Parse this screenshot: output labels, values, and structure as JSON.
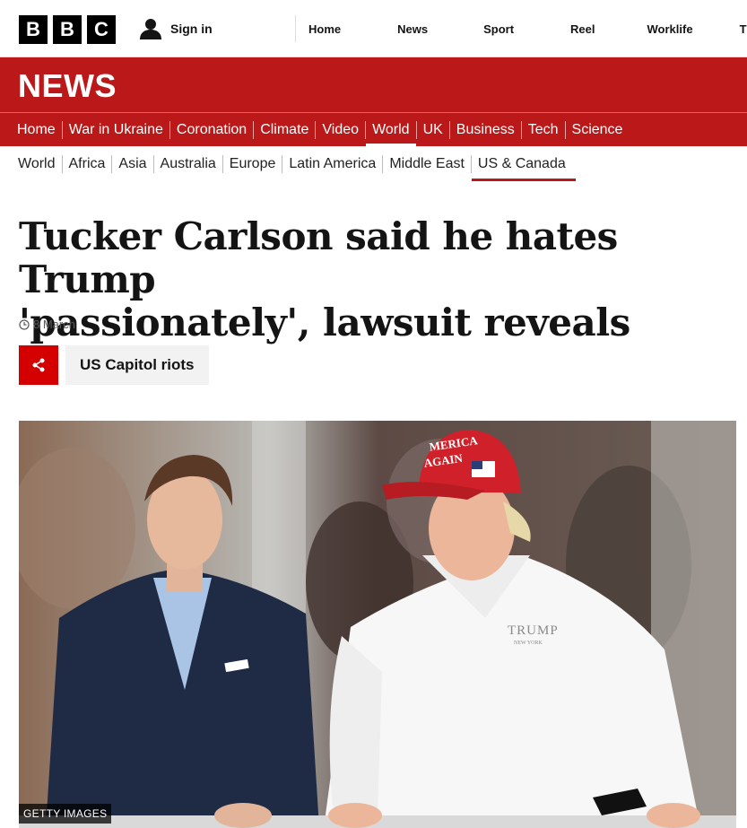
{
  "brand": {
    "letters": [
      "B",
      "B",
      "C"
    ]
  },
  "account": {
    "signin_label": "Sign in",
    "icon": "person-icon"
  },
  "top_nav": [
    "Home",
    "News",
    "Sport",
    "Reel",
    "Worklife",
    "T"
  ],
  "banner": {
    "title": "NEWS",
    "color": "#bb1919"
  },
  "section_nav": {
    "items": [
      "Home",
      "War in Ukraine",
      "Coronation",
      "Climate",
      "Video",
      "World",
      "UK",
      "Business",
      "Tech",
      "Science"
    ],
    "active": "World"
  },
  "sub_nav": {
    "items": [
      "World",
      "Africa",
      "Asia",
      "Australia",
      "Europe",
      "Latin America",
      "Middle East",
      "US & Canada"
    ],
    "active": "US & Canada"
  },
  "article": {
    "headline_line1": "Tucker Carlson said he hates Trump",
    "headline_line2": "'passionately', lawsuit reveals",
    "date": "8 March",
    "topic": "US Capitol riots"
  },
  "hero_image": {
    "credit": "GETTY IMAGES",
    "cap_text_line1": "MERICA",
    "cap_text_line2": "AGAIN",
    "shirt_logo": "TRUMP",
    "shirt_logo_sub": "NEW YORK"
  },
  "colors": {
    "accent": "#bb1919",
    "share": "#d40000",
    "text": "#141414"
  }
}
